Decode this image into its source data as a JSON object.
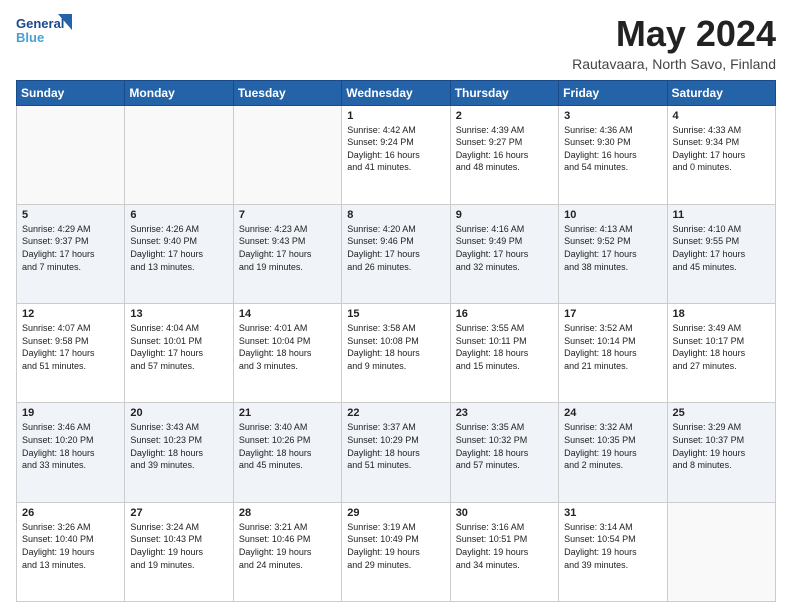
{
  "logo": {
    "line1": "General",
    "line2": "Blue"
  },
  "title": "May 2024",
  "subtitle": "Rautavaara, North Savo, Finland",
  "weekdays": [
    "Sunday",
    "Monday",
    "Tuesday",
    "Wednesday",
    "Thursday",
    "Friday",
    "Saturday"
  ],
  "weeks": [
    [
      {
        "day": "",
        "info": ""
      },
      {
        "day": "",
        "info": ""
      },
      {
        "day": "",
        "info": ""
      },
      {
        "day": "1",
        "info": "Sunrise: 4:42 AM\nSunset: 9:24 PM\nDaylight: 16 hours\nand 41 minutes."
      },
      {
        "day": "2",
        "info": "Sunrise: 4:39 AM\nSunset: 9:27 PM\nDaylight: 16 hours\nand 48 minutes."
      },
      {
        "day": "3",
        "info": "Sunrise: 4:36 AM\nSunset: 9:30 PM\nDaylight: 16 hours\nand 54 minutes."
      },
      {
        "day": "4",
        "info": "Sunrise: 4:33 AM\nSunset: 9:34 PM\nDaylight: 17 hours\nand 0 minutes."
      }
    ],
    [
      {
        "day": "5",
        "info": "Sunrise: 4:29 AM\nSunset: 9:37 PM\nDaylight: 17 hours\nand 7 minutes."
      },
      {
        "day": "6",
        "info": "Sunrise: 4:26 AM\nSunset: 9:40 PM\nDaylight: 17 hours\nand 13 minutes."
      },
      {
        "day": "7",
        "info": "Sunrise: 4:23 AM\nSunset: 9:43 PM\nDaylight: 17 hours\nand 19 minutes."
      },
      {
        "day": "8",
        "info": "Sunrise: 4:20 AM\nSunset: 9:46 PM\nDaylight: 17 hours\nand 26 minutes."
      },
      {
        "day": "9",
        "info": "Sunrise: 4:16 AM\nSunset: 9:49 PM\nDaylight: 17 hours\nand 32 minutes."
      },
      {
        "day": "10",
        "info": "Sunrise: 4:13 AM\nSunset: 9:52 PM\nDaylight: 17 hours\nand 38 minutes."
      },
      {
        "day": "11",
        "info": "Sunrise: 4:10 AM\nSunset: 9:55 PM\nDaylight: 17 hours\nand 45 minutes."
      }
    ],
    [
      {
        "day": "12",
        "info": "Sunrise: 4:07 AM\nSunset: 9:58 PM\nDaylight: 17 hours\nand 51 minutes."
      },
      {
        "day": "13",
        "info": "Sunrise: 4:04 AM\nSunset: 10:01 PM\nDaylight: 17 hours\nand 57 minutes."
      },
      {
        "day": "14",
        "info": "Sunrise: 4:01 AM\nSunset: 10:04 PM\nDaylight: 18 hours\nand 3 minutes."
      },
      {
        "day": "15",
        "info": "Sunrise: 3:58 AM\nSunset: 10:08 PM\nDaylight: 18 hours\nand 9 minutes."
      },
      {
        "day": "16",
        "info": "Sunrise: 3:55 AM\nSunset: 10:11 PM\nDaylight: 18 hours\nand 15 minutes."
      },
      {
        "day": "17",
        "info": "Sunrise: 3:52 AM\nSunset: 10:14 PM\nDaylight: 18 hours\nand 21 minutes."
      },
      {
        "day": "18",
        "info": "Sunrise: 3:49 AM\nSunset: 10:17 PM\nDaylight: 18 hours\nand 27 minutes."
      }
    ],
    [
      {
        "day": "19",
        "info": "Sunrise: 3:46 AM\nSunset: 10:20 PM\nDaylight: 18 hours\nand 33 minutes."
      },
      {
        "day": "20",
        "info": "Sunrise: 3:43 AM\nSunset: 10:23 PM\nDaylight: 18 hours\nand 39 minutes."
      },
      {
        "day": "21",
        "info": "Sunrise: 3:40 AM\nSunset: 10:26 PM\nDaylight: 18 hours\nand 45 minutes."
      },
      {
        "day": "22",
        "info": "Sunrise: 3:37 AM\nSunset: 10:29 PM\nDaylight: 18 hours\nand 51 minutes."
      },
      {
        "day": "23",
        "info": "Sunrise: 3:35 AM\nSunset: 10:32 PM\nDaylight: 18 hours\nand 57 minutes."
      },
      {
        "day": "24",
        "info": "Sunrise: 3:32 AM\nSunset: 10:35 PM\nDaylight: 19 hours\nand 2 minutes."
      },
      {
        "day": "25",
        "info": "Sunrise: 3:29 AM\nSunset: 10:37 PM\nDaylight: 19 hours\nand 8 minutes."
      }
    ],
    [
      {
        "day": "26",
        "info": "Sunrise: 3:26 AM\nSunset: 10:40 PM\nDaylight: 19 hours\nand 13 minutes."
      },
      {
        "day": "27",
        "info": "Sunrise: 3:24 AM\nSunset: 10:43 PM\nDaylight: 19 hours\nand 19 minutes."
      },
      {
        "day": "28",
        "info": "Sunrise: 3:21 AM\nSunset: 10:46 PM\nDaylight: 19 hours\nand 24 minutes."
      },
      {
        "day": "29",
        "info": "Sunrise: 3:19 AM\nSunset: 10:49 PM\nDaylight: 19 hours\nand 29 minutes."
      },
      {
        "day": "30",
        "info": "Sunrise: 3:16 AM\nSunset: 10:51 PM\nDaylight: 19 hours\nand 34 minutes."
      },
      {
        "day": "31",
        "info": "Sunrise: 3:14 AM\nSunset: 10:54 PM\nDaylight: 19 hours\nand 39 minutes."
      },
      {
        "day": "",
        "info": ""
      }
    ]
  ],
  "colors": {
    "header_bg": "#2563a8",
    "accent": "#1a4a8a"
  }
}
